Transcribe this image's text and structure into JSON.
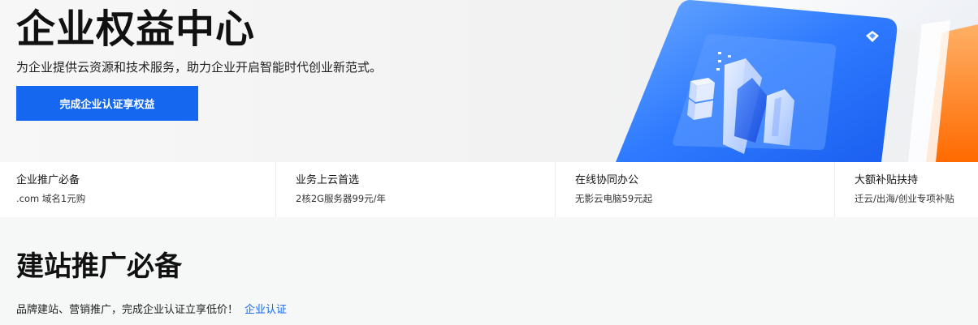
{
  "hero": {
    "title": "企业权益中心",
    "subtitle": "为企业提供云资源和技术服务，助力企业开启智能时代创业新范式。",
    "cta_label": "完成企业认证享权益",
    "accent_color": "#1467ee"
  },
  "benefits": [
    {
      "title": "企业推广必备",
      "desc": ".com 域名1元购"
    },
    {
      "title": "业务上云首选",
      "desc": "2核2G服务器99元/年"
    },
    {
      "title": "在线协同办公",
      "desc": "无影云电脑59元起"
    },
    {
      "title": "大额补贴扶持",
      "desc": "迁云/出海/创业专项补贴"
    }
  ],
  "section": {
    "title": "建站推广必备",
    "desc": "品牌建站、营销推广，完成企业认证立享低价！",
    "link_label": "企业认证"
  }
}
